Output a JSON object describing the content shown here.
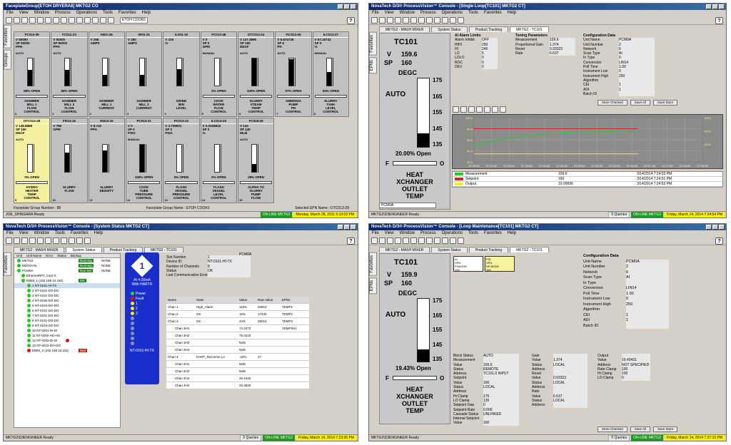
{
  "p1": {
    "title": "FaceplateGroup[ETOH DRYERA8] MKTG2 CO",
    "menu": [
      "File",
      "View",
      "Window",
      "Process",
      "Operations",
      "Tools",
      "Favorites",
      "Help"
    ],
    "toolbar_select": "ETOH COOK0",
    "side_tabs": [
      "Favorites",
      "Groups"
    ],
    "faceplates": [
      {
        "tag": "FC013-39",
        "lines": [
          "V 50000",
          "SP 50000",
          "PPH"
        ],
        "mode": "AUTO",
        "level": 0.58,
        "pct": "58% OPEN",
        "name": [
          "HAMMER",
          "MILL 1",
          "FLOW",
          "CONTROL"
        ],
        "idx": "0"
      },
      {
        "tag": "FC011-23",
        "lines": [
          "V 50000",
          "SP 50000",
          "PPH"
        ],
        "mode": "AUTO",
        "level": 0.59,
        "pct": "59% OPEN",
        "name": [
          "HAMMER",
          "MILL 2",
          "FLOW",
          "CONTROL"
        ],
        "idx": "1"
      },
      {
        "tag": "II001-26",
        "lines": [
          "V 256",
          "AMPS"
        ],
        "mode": "",
        "level": 0.4,
        "pct": "",
        "name": [
          "HAMMER",
          "MILL 1",
          "CURRENT"
        ],
        "idx": "2"
      },
      {
        "tag": "II001-31",
        "lines": [
          "V 250",
          "AMPS"
        ],
        "mode": "",
        "level": 0.4,
        "pct": "",
        "name": [
          "HAMMER",
          "MILL 2",
          "CURRENT"
        ],
        "idx": "3"
      },
      {
        "tag": "IL001-19",
        "lines": [
          "V 100",
          "%"
        ],
        "mode": "",
        "level": 0.6,
        "pct": "",
        "name": [
          "GRIND",
          "BIN",
          "LEVEL"
        ],
        "idx": "4"
      },
      {
        "tag": "FC013-48",
        "lines": [
          "V 0",
          "SP 0",
          "GPM"
        ],
        "mode": "MANUAL",
        "level": 0.0,
        "pct": "0% OPEN",
        "name": [
          "COOK",
          "WATER",
          "FLOW",
          "CONTROL"
        ],
        "idx": "5"
      },
      {
        "tag": "DTC013-24",
        "lines": [
          "V 147.3895",
          "SP 150",
          "DEGF"
        ],
        "mode": "AUTO",
        "level": 1.0,
        "pct": "100% OPEN",
        "name": [
          "SLURRY",
          "STEAM",
          "TEMP",
          "CONTROL"
        ],
        "idx": "6"
      },
      {
        "tag": "FIC013-25",
        "lines": [
          "V 5.674726",
          "SP 6",
          "PH"
        ],
        "mode": "AUTO",
        "level": 0.97,
        "pct": "97% OPEN",
        "name": [
          "AMMONIA",
          "PUMP",
          "PH",
          "CONTROL"
        ],
        "idx": "7"
      },
      {
        "tag": "ILC013-27",
        "lines": [
          "V 67.15742",
          "SP 0",
          "%"
        ],
        "mode": "MANUAL",
        "level": 0.5,
        "pct": "50% OPEN",
        "name": [
          "SLURRY",
          "TANK",
          "LEVEL",
          "CONTROL"
        ],
        "idx": "8"
      },
      {
        "tag": "DTC013-28",
        "lines": [
          "V 148.8888",
          "SP 150",
          "DEGF"
        ],
        "mode": "AUTO",
        "level": 0.0,
        "pct": "0% OPEN",
        "name": [
          "HYDRO",
          "HEATER",
          "TEMP",
          "CONTROL"
        ],
        "idx": "9",
        "selected": true
      },
      {
        "tag": "FI013-16",
        "lines": [
          "V 799",
          "GPM"
        ],
        "mode": "",
        "level": 0.7,
        "pct": "",
        "name": [
          "SLURRY",
          "FLOW"
        ],
        "idx": "10"
      },
      {
        "tag": "DI013-15",
        "lines": [
          "V 8.742",
          "PPG"
        ],
        "mode": "",
        "level": 0.8,
        "pct": "",
        "name": [
          "SLURRY",
          "DENSITY"
        ],
        "idx": "11"
      },
      {
        "tag": "PC013-21",
        "lines": [
          "V 0",
          "SP 0",
          "PSIG"
        ],
        "mode": "MANUAL",
        "level": 1.0,
        "pct": "100% OPEN",
        "name": [
          "COOK",
          "TUBE",
          "PRESSURE",
          "CONTROL"
        ],
        "idx": "12"
      },
      {
        "tag": "PC013-22",
        "lines": [
          "V 3.709001",
          "SP 0",
          "PSIA"
        ],
        "mode": "",
        "level": 0.0,
        "pct": "0% OPEN",
        "name": [
          "FLASH",
          "VESSEL",
          "PRESSURE",
          "CONTROL"
        ],
        "idx": "13"
      },
      {
        "tag": "ILC013-23",
        "lines": [
          "V 0.0328833",
          "SP 0",
          "%"
        ],
        "mode": "",
        "level": 0.0,
        "pct": "0% OPEN",
        "name": [
          "FLASH",
          "VESSEL",
          "LEVEL",
          "CONTROL"
        ],
        "idx": "14"
      },
      {
        "tag": "FC018-29",
        "lines": [
          "V 140",
          "SP 140",
          "MLM"
        ],
        "mode": "AUTO",
        "level": 0.28,
        "pct": "28% OPEN",
        "name": [
          "ALPHA TO",
          "SLURRY",
          "PUMP",
          "FLOW"
        ],
        "idx": "15"
      }
    ],
    "footer_left": "Faceplate Group Number : 88",
    "footer_mid": "Faceplate Group Name : ETOH COOK0",
    "footer_right": "Selected EPN Name : DTC013-28",
    "status_left": "JOE_SHINGARA   Ready",
    "online": "ON-LINE MKTG2",
    "clock": "Monday, March 28, 2011  5:13:03 PM"
  },
  "p2": {
    "title": "NovaTech D/3® ProcessVision™ Console - [Single Loop[TC101] MKTG2 CT]",
    "menu": [
      "File",
      "View",
      "Window",
      "Process",
      "Operations",
      "Tools",
      "Favorites",
      "Help"
    ],
    "tabs": [
      "MKTG2 - MASH MIXER",
      "System Status",
      "Product Tracking",
      "MKTG2 - TC101"
    ],
    "side_tabs": [
      "Favorites",
      "EPNs"
    ],
    "faceplate": {
      "tag": "TC101",
      "v_label": "V",
      "v": "159.6",
      "sp_label": "SP",
      "sp": "160",
      "units": "DEGC",
      "mode": "AUTO",
      "ticks": [
        "175",
        "165",
        "155",
        "145",
        "135"
      ],
      "level": 0.2,
      "open": "20.00% Open",
      "name": [
        "HEAT",
        "XCHANGER",
        "OUTLET",
        "TEMP"
      ],
      "f": "F",
      "o": "O"
    },
    "alarm_limits": {
      "title": "AI Alarm Limits",
      "rows": [
        [
          "Alarm Inhibit",
          "OFF"
        ],
        [
          "HIHI",
          "250"
        ],
        [
          "HI",
          "245"
        ],
        [
          "LO",
          "5"
        ],
        [
          "LOLO",
          "0"
        ],
        [
          "ROC",
          "0"
        ],
        [
          "DEV",
          "0"
        ]
      ]
    },
    "tuning": {
      "title": "Tuning Parameters",
      "rows": [
        [
          "Measurement",
          "159.6"
        ],
        [
          "Proportional Gain",
          "1.374"
        ],
        [
          "Reset",
          "0.93323"
        ],
        [
          "Rate",
          "6.637"
        ]
      ]
    },
    "config": {
      "title": "Configuration Data",
      "rows": [
        [
          "Unit Name",
          "PCM0A"
        ],
        [
          "Unit Number",
          "2"
        ],
        [
          "Network",
          "6"
        ],
        [
          "Scan Type",
          "AI"
        ],
        [
          "In Type",
          "0"
        ],
        [
          "Conversion",
          "LIN14"
        ],
        [
          "Poll Time",
          "1.00"
        ],
        [
          "Instrument Low",
          "0"
        ],
        [
          "Instrument High",
          "250"
        ],
        [
          "Algorithm",
          ""
        ],
        [
          "CEI",
          "1"
        ],
        [
          "ADI",
          "1"
        ],
        [
          "Batch ID",
          ""
        ]
      ]
    },
    "buttons": [
      "Store Checked",
      "Save All",
      "Save Store"
    ],
    "chart_data": {
      "type": "line",
      "series": [
        {
          "name": "Measurement",
          "values": [
            130,
            135,
            140,
            144,
            147,
            149,
            151,
            152,
            153,
            154,
            154.5,
            155,
            155.3,
            155.5
          ]
        },
        {
          "name": "Setpoint",
          "values": [
            160,
            160,
            160,
            160,
            160,
            160,
            160,
            160,
            160,
            160,
            160,
            160,
            160,
            160
          ]
        },
        {
          "name": "Output",
          "values": [
            18,
            18,
            18,
            18,
            18,
            18,
            18,
            18,
            18,
            18,
            18,
            18,
            18,
            18
          ]
        }
      ],
      "x": [
        "07:22:00",
        "07:22:30",
        "07:23:00",
        "07:23:30",
        "07:24:00",
        "07:24:30",
        "07:25:00",
        "07:25:30",
        "07:26:00",
        "07:26:30",
        "07:27:00",
        "07:27:30",
        "07:28:00",
        "07:28:30"
      ],
      "yticks_left": [
        "100.0",
        "80.0",
        "60.0",
        "40.0",
        "20.0"
      ],
      "yticks_right": [
        "160.0",
        "140.0",
        "120.0"
      ]
    },
    "legend": [
      {
        "name": "Measurement",
        "val": "159.6",
        "time": "3/14/2014 7:24:53 PM",
        "color": "#22cc22"
      },
      {
        "name": "Setpoint",
        "val": "160",
        "time": "3/14/2014 7:24:51 PM",
        "color": "#dd2222"
      },
      {
        "name": "Output",
        "val": "19.99936",
        "time": "3/14/2014 7:24:53 PM",
        "color": "#eeee22"
      }
    ],
    "combo": "PCM0A",
    "status_left": "MKTG2\\D3ENGINEER   Ready",
    "queries": "0 Queries",
    "online": "ON-LINE MKTG2",
    "clock": "Friday, March 14, 2014  7:24:54 PM"
  },
  "p3": {
    "title": "NovaTech D/3® ProcessVision™ Console - [System Status MKTG2 CT]",
    "menu": [
      "File",
      "View",
      "Window",
      "Tools",
      "Favorites",
      "Help"
    ],
    "tabs": [
      "MKTG2 - MASH MIXER",
      "System Status",
      "Product Tracking",
      "MKTG2 - TC101"
    ],
    "side_tabs": [
      "Favorites"
    ],
    "tree_headers": [
      "Unit",
      "Unit Name",
      "Error",
      "Status",
      "Backup"
    ],
    "tree_rows": [
      {
        "t": "MKTG2",
        "status": "Running",
        "backup": "NONE",
        "st": "g"
      },
      {
        "t": "MDOOAN",
        "status": "Running",
        "backup": "NONE",
        "st": "g"
      },
      {
        "t": "PCM0A",
        "status": "Run Sel",
        "backup": "NONE",
        "st": "g"
      },
      {
        "t": "EthernetRPC Card 0",
        "status": "",
        "backup": "",
        "st": ""
      },
      {
        "t": "EBIM_1 (192.168.10.150)",
        "status": "OK",
        "backup": "",
        "st": "g"
      },
      {
        "t": "1 NT-0101-HI-TX",
        "status": "",
        "backup": "",
        "st": "sel"
      },
      {
        "t": "2 NT-0101-DO-DO",
        "status": "",
        "backup": "",
        "st": ""
      },
      {
        "t": "3 NT-0101-DO-DO",
        "status": "",
        "backup": "",
        "st": ""
      },
      {
        "t": "4 NT-0105-DO-DO",
        "status": "",
        "backup": "",
        "st": ""
      },
      {
        "t": "5 NT-0104-DO-DO",
        "status": "",
        "backup": "",
        "st": ""
      },
      {
        "t": "6 NT-0101-DO-DO",
        "status": "",
        "backup": "",
        "st": ""
      },
      {
        "t": "7 NT-0101-DO-DO",
        "status": "",
        "backup": "",
        "st": ""
      },
      {
        "t": "8 NT-0101-DO-DO",
        "status": "",
        "backup": "",
        "st": ""
      },
      {
        "t": "9 NT-0103-DO-DO",
        "status": "",
        "backup": "",
        "st": ""
      },
      {
        "t": "10 NT-0201-HI-DI",
        "status": "",
        "backup": "",
        "st": ""
      },
      {
        "t": "11 NT-0202-HO-HS",
        "status": "",
        "backup": "",
        "st": ""
      },
      {
        "t": "12 NT-0203-DI-DI",
        "status": "",
        "backup": "",
        "st": "err"
      },
      {
        "t": "13 NT-0210-DO-DO",
        "status": "",
        "backup": "",
        "st": ""
      },
      {
        "t": "EBIM_2 (192.168.10.151)",
        "status": "Bad",
        "backup": "",
        "st": "r"
      }
    ],
    "card": {
      "num": "1",
      "line1": "AI 4-20mA",
      "line2": "With HART®",
      "leds": [
        "Power",
        "Fault",
        "1",
        "2",
        "3"
      ],
      "foot": "NT-0101-HI-TX"
    },
    "info": {
      "rows": [
        [
          "Slot Number",
          "1"
        ],
        [
          "Device ID",
          "NT-0101-HI-TX"
        ],
        [
          "Number of Channels",
          "8"
        ],
        [
          "Status",
          "OK"
        ],
        [
          "Last Communication Error",
          ""
        ]
      ],
      "unit": "PCM0A"
    },
    "ch_headers": [
      "Name",
      "State",
      "Value",
      "Raw Value",
      "EPNs"
    ],
    "channels": [
      [
        "Chan 1",
        "High_Alarm",
        "110%",
        "30912",
        "TEMP1"
      ],
      [
        "Chan 2",
        "OK",
        "16%",
        "17430",
        "TEMP2"
      ],
      [
        "Chan 3",
        "OK",
        "44%",
        "29010",
        "TEMP3"
      ],
      [
        "Chan 3H1",
        "",
        "72.2473",
        "",
        "TEMP3H1"
      ],
      [
        "Chan 3H2",
        "",
        "75.0122",
        "",
        ""
      ],
      [
        "Chan 3H3",
        "",
        "NaN",
        "",
        ""
      ],
      [
        "Chan 3H4",
        "",
        "NaN",
        "",
        ""
      ],
      [
        "Chan 4",
        "HART_NoComm Lo",
        "-24%",
        "27",
        ""
      ],
      [
        "Chan 4H1",
        "",
        "NaN",
        "",
        ""
      ],
      [
        "Chan 4H2",
        "",
        "NaN",
        "",
        ""
      ],
      [
        "Chan 4H3",
        "",
        "25.4340",
        "",
        ""
      ],
      [
        "Chan 4H4",
        "",
        "25.3820",
        "",
        ""
      ]
    ],
    "status_left": "MKTG2\\D3ENGINEER   Ready",
    "queries": "0 Queries",
    "online": "ON-LINE MKTG2",
    "clock": "Friday, March 14, 2014  7:23:30 PM"
  },
  "p4": {
    "title": "NovaTech D/3® ProcessVision™ Console - [Loop Maintenance[TC101] MKTG2 CT]",
    "menu": [
      "File",
      "View",
      "Window",
      "Process",
      "Operations",
      "Tools",
      "Favorites",
      "Help"
    ],
    "tabs": [
      "MKTG2 - MASH MIXER",
      "System Status",
      "Product Tracking",
      "MKTG2 - TC101"
    ],
    "side_tabs": [
      "Favorites",
      "EPNs"
    ],
    "faceplate": {
      "tag": "TC101",
      "v_label": "V",
      "v": "159.9",
      "sp_label": "SP",
      "sp": "160",
      "units": "DEGC",
      "mode": "AUTO",
      "ticks": [
        "175",
        "165",
        "155",
        "145",
        "135"
      ],
      "level": 0.19,
      "open": "19.43% Open",
      "name": [
        "HEAT",
        "XCHANGER",
        "OUTLET",
        "TEMP"
      ],
      "f": "F",
      "o": "O"
    },
    "mini_tags": [
      {
        "a": "AI",
        "b": "VPN",
        "c": "PHASOR",
        "d": "159"
      },
      {
        "a": "PID",
        "b": "VPN",
        "c": "SP/ADDR",
        "d": "160"
      }
    ],
    "config": {
      "title": "Configuration Data",
      "rows": [
        [
          "Unit Name",
          "PCM0A"
        ],
        [
          "Unit Number",
          "2"
        ],
        [
          "Network",
          "6"
        ],
        [
          "Scan Type",
          "AI"
        ],
        [
          "In Type",
          ""
        ],
        [
          "Conversion",
          "LIN14"
        ],
        [
          "Poll Time",
          "1.00"
        ],
        [
          "Instrument Low",
          "0"
        ],
        [
          "Instrument High",
          "250"
        ],
        [
          "Algorithm",
          ""
        ],
        [
          "CEI",
          "1"
        ],
        [
          "ADI",
          "1"
        ],
        [
          "Batch ID",
          ""
        ]
      ]
    },
    "block": {
      "rows": [
        [
          "Block Status",
          "AUTO"
        ],
        [
          "Measurement",
          ""
        ],
        [
          "Value",
          "159.6"
        ],
        [
          "Status",
          "REMOTE"
        ],
        [
          "Address",
          "TC101.0 INPUT"
        ],
        [
          "Setpoint",
          ""
        ],
        [
          "Value",
          "160"
        ],
        [
          "Status",
          "LOCAL"
        ],
        [
          "Address",
          ""
        ],
        [
          "Hi Clamp",
          "175"
        ],
        [
          "LO Clamp",
          "135"
        ],
        [
          "Setpoint Gap",
          "0"
        ],
        [
          "Setpoint Rate",
          "0.000"
        ],
        [
          "Cascade Status",
          "UNLINKED"
        ],
        [
          "Internal Setpoint",
          ""
        ],
        [
          "Value",
          "160"
        ]
      ]
    },
    "gain": {
      "rows": [
        [
          "Gain",
          ""
        ],
        [
          "Value",
          "1.374"
        ],
        [
          "Status",
          "LOCAL"
        ],
        [
          "Address",
          ""
        ],
        [
          "Reset",
          ""
        ],
        [
          "Value",
          "0.93323"
        ],
        [
          "Status",
          "LOCAL"
        ],
        [
          "Address",
          ""
        ],
        [
          "Rate",
          ""
        ],
        [
          "Value",
          "6.637"
        ],
        [
          "Status",
          "LOCAL"
        ],
        [
          "Address",
          ""
        ]
      ]
    },
    "output": {
      "rows": [
        [
          "Output",
          ""
        ],
        [
          "Value",
          "19.43431"
        ],
        [
          "Address",
          "NOT SPECIFIED"
        ],
        [
          "Rate Clamp",
          "100"
        ],
        [
          "Hi Clamp",
          "100"
        ],
        [
          "LO Clamp",
          "0"
        ]
      ]
    },
    "buttons": [
      "Store Checked",
      "Save All",
      "Save Store"
    ],
    "status_left": "MKTG2\\D3ENGINEER   Ready",
    "queries": "0 Queries",
    "online": "ON-LINE MKTG2",
    "clock": "Friday, March 14, 2014  7:27:15 PM"
  },
  "colors": {
    "titlebar": "#0a246a",
    "online": "#1c9a1c",
    "clock": "#fff200",
    "card": "#1a2ecc",
    "measurement": "#22cc22",
    "setpoint": "#dd2222",
    "output": "#eeee22"
  }
}
